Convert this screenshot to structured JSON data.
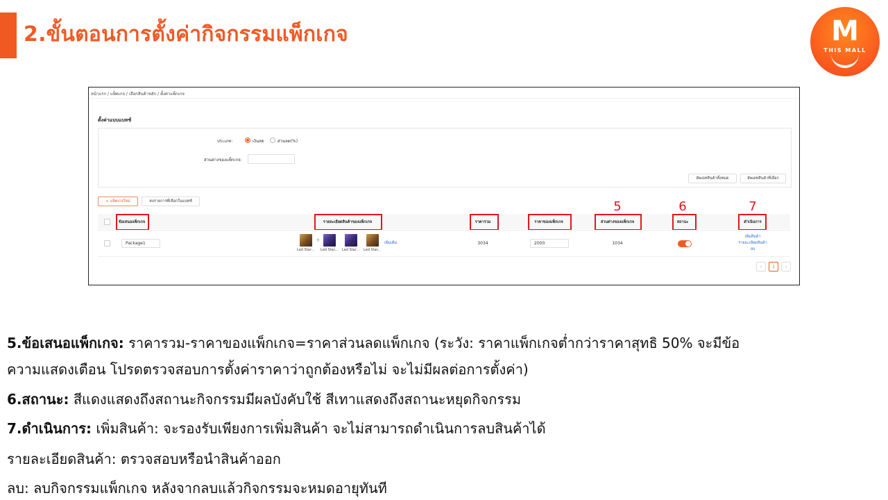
{
  "slide": {
    "title": "2.ขั้นตอนการตั้งค่ากิจกรรมแพ็กเกจ",
    "logo_letter": "M",
    "logo_text": "THIS MALL",
    "accent_color": "#f05a22",
    "highlight_color": "#e0161d"
  },
  "screenshot": {
    "breadcrumb": "หน้าแรก / แพ็คเกจ / เลือกสินค้าหลัก / ตั้งค่าแพ็กเกจ",
    "section_heading": "ตั้งค่าแบบแบทช์",
    "type_label": "ประเภท:",
    "type_options": [
      "เงินสด",
      "ส่วนลด(%)"
    ],
    "type_selected": "เงินสด",
    "discount_label": "ส่วนต่างของแพ็กเกจ:",
    "update_all_button": "อัพเดทสินค้าทั้งหมด",
    "update_selected_button": "อัพเดทสินค้าที่เลือก",
    "new_package_button": "+ แพ็คเกจใหม่",
    "delete_batch_button": "ลบรายการที่เลือกในแบทช์",
    "columns": [
      "ข้อเสนอแพ็กเกจ",
      "รายละเอียดสินค้าของแพ็กเกจ",
      "ราคารวม",
      "ราคาของแพ็กเกจ",
      "ส่วนต่างของแพ็กเกจ",
      "สถานะ",
      "ดำเนินการ"
    ],
    "callout_numbers": [
      "5",
      "6",
      "7"
    ],
    "row": {
      "package_name": "Package1",
      "product_captions": [
        "Led Star...",
        "Led Star...",
        "Led Star...",
        "Led Star..."
      ],
      "add_link": "เพิ่มเติม",
      "total_price": "3034",
      "package_price": "2000",
      "package_diff": "1034",
      "status_on": true,
      "actions": [
        "เพิ่มสินค้า",
        "รายละเอียดสินค้า",
        "ลบ"
      ]
    },
    "pagination": {
      "prev": "‹",
      "current": "1",
      "next": "›"
    }
  },
  "notes": {
    "line1_bold": "5.ข้อเสนอแพ็กเกจ:",
    "line1_text": " ราคารวม-ราคาของแพ็กเกจ=ราคาส่วนลดแพ็กเกจ (ระวัง: ราคาแพ็กเกจต่ำกว่าราคาสุทธิ 50% จะมีข้อ",
    "line2_text": "ความแสดงเตือน โปรดตรวจสอบการตั้งค่าราคาว่าถูกต้องหรือไม่ จะไม่มีผลต่อการตั้งค่า)",
    "line3_bold": "6.สถานะ:",
    "line3_text": " สีแดงแสดงถึงสถานะกิจกรรมมีผลบังคับใช้ สีเทาแสดงถึงสถานะหยุดกิจกรรม",
    "line4_bold": "7.ดำเนินการ:",
    "line4_text": " เพิ่มสินค้า: จะรองรับเพียงการเพิ่มสินค้า จะไม่สามารถดำเนินการลบสินค้าได้",
    "line5_text": "รายละเอียดสินค้า: ตรวจสอบหรือนำสินค้าออก",
    "line6_text": "ลบ: ลบกิจกรรมแพ็กเกจ หลังจากลบแล้วกิจกรรมจะหมดอายุทันที"
  }
}
